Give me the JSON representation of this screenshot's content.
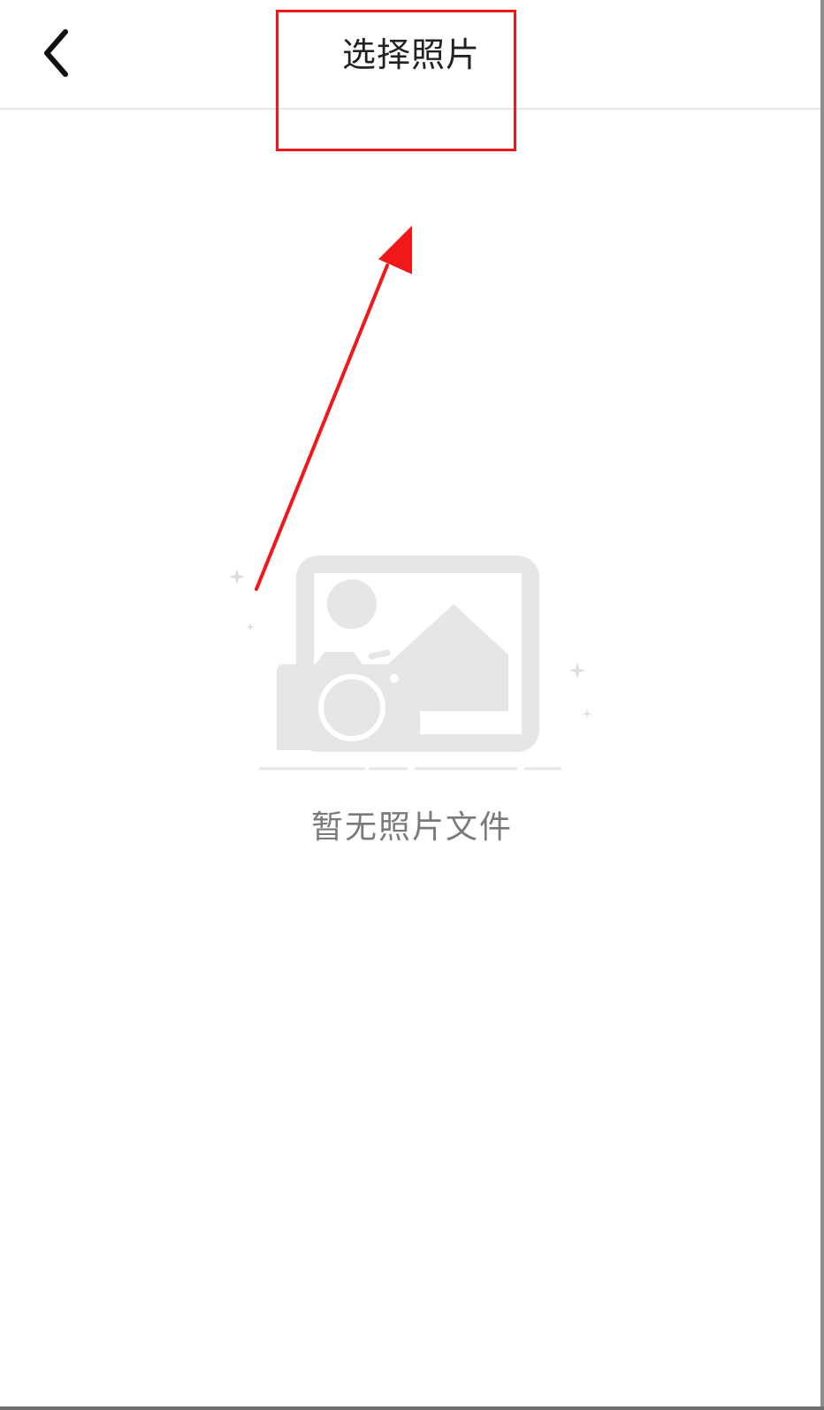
{
  "header": {
    "back_icon": "chevron-left-icon",
    "title": "选择照片"
  },
  "empty_state": {
    "illustration_icon": "photo-camera-empty-icon",
    "message": "暂无照片文件"
  },
  "annotation": {
    "box_color": "#f01818",
    "arrow_color": "#f01818"
  },
  "colors": {
    "background": "#ffffff",
    "title_text": "#222222",
    "empty_text": "#7a7a7a",
    "illustration": "#e6e6e6"
  }
}
